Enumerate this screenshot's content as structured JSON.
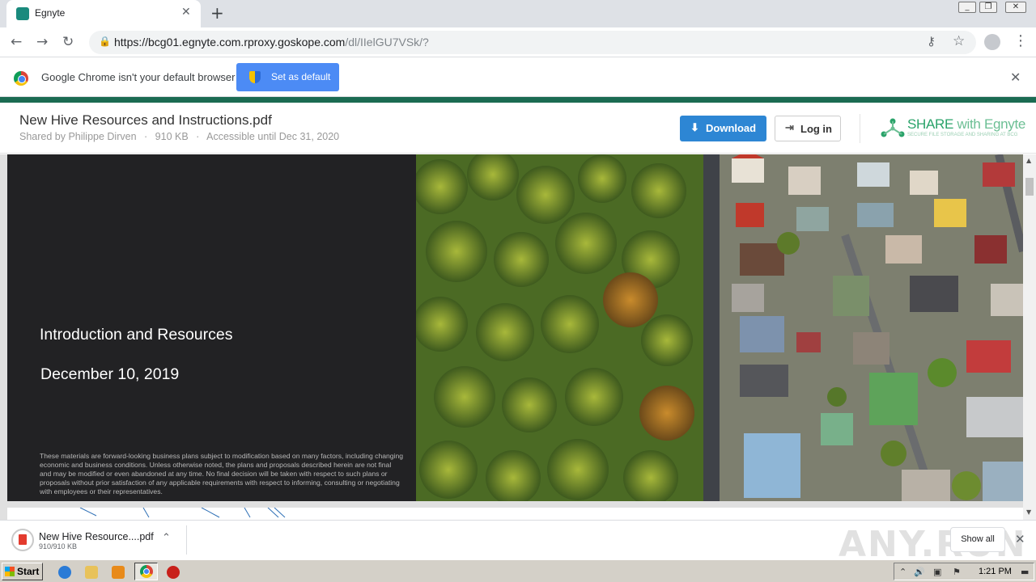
{
  "browser": {
    "tab_title": "Egnyte",
    "new_tab_symbol": "+",
    "url_main": "https://bcg01.egnyte.com.rproxy.goskope.com",
    "url_path": "/dl/IIelGU7VSk/?",
    "window_controls": [
      "minimize-icon",
      "restore-icon",
      "close-icon"
    ]
  },
  "infobar": {
    "message": "Google Chrome isn't your default browser",
    "set_default_label": "Set as default"
  },
  "egnyte": {
    "file_title": "New Hive Resources and Instructions.pdf",
    "shared_by": "Shared by Philippe Dirven",
    "file_size": "910 KB",
    "accessible_until": "Accessible until Dec 31, 2020",
    "separator": "·",
    "download_label": "Download",
    "login_label": "Log in",
    "brand_share": "SHARE",
    "brand_with": " with Egnyte",
    "brand_tagline": "SECURE FILE STORAGE AND SHARING AT BCG",
    "accent_color": "#1b6b52",
    "button_color": "#2d86d4"
  },
  "slide": {
    "title": "Introduction and Resources",
    "date": "December 10, 2019",
    "disclaimer": "These materials are forward-looking business plans subject to modification based on many factors, including changing economic and business conditions. Unless otherwise noted, the plans and proposals described herein are not final and may be modified or even abandoned at any time. No final decision will be taken with respect to such plans or proposals without prior satisfaction of any applicable requirements with respect to informing, consulting or negotiating with employees or their representatives."
  },
  "download_shelf": {
    "file_name": "New Hive Resource....pdf",
    "progress": "910/910 KB",
    "show_all": "Show all",
    "watermark": "ANY.RUN"
  },
  "taskbar": {
    "start_label": "Start",
    "clock": "1:21 PM",
    "quick_launch": [
      "ie-icon",
      "folder-icon",
      "media-player-icon",
      "chrome-icon",
      "stop-icon"
    ]
  }
}
